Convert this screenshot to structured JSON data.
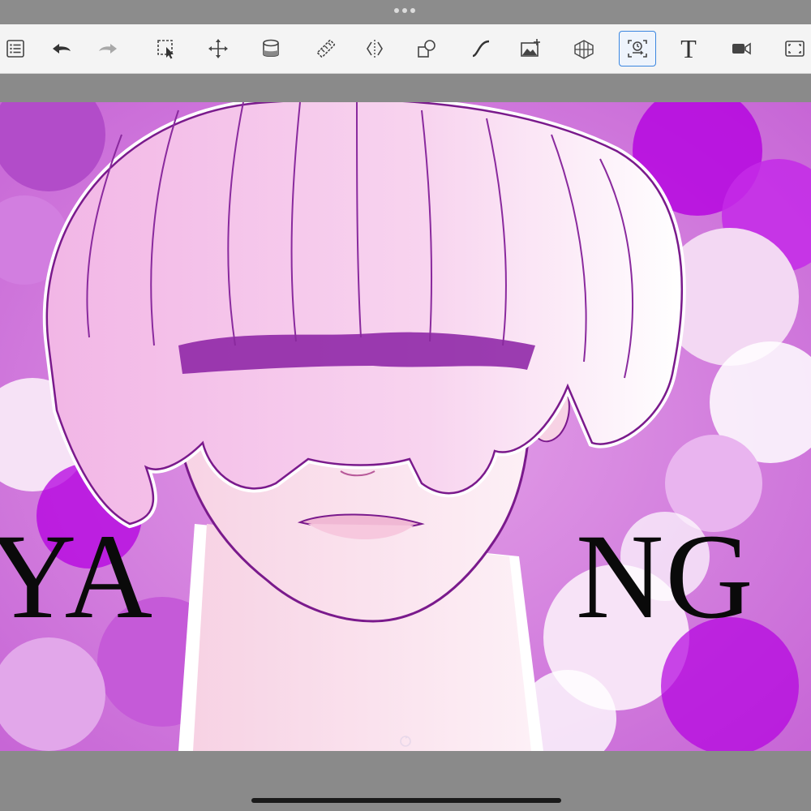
{
  "toolbar": {
    "tools": [
      {
        "name": "layers-list-icon",
        "active": false
      },
      {
        "name": "undo-icon",
        "active": false
      },
      {
        "name": "redo-icon",
        "active": false
      },
      {
        "name": "selection-icon",
        "active": false
      },
      {
        "name": "transform-move-icon",
        "active": false
      },
      {
        "name": "fill-bucket-icon",
        "active": false
      },
      {
        "name": "ruler-icon",
        "active": false
      },
      {
        "name": "symmetry-icon",
        "active": false
      },
      {
        "name": "shape-icon",
        "active": false
      },
      {
        "name": "curve-icon",
        "active": false
      },
      {
        "name": "add-image-icon",
        "active": false
      },
      {
        "name": "perspective-guide-icon",
        "active": false
      },
      {
        "name": "time-lapse-icon",
        "active": true
      },
      {
        "name": "text-tool-icon",
        "active": false
      },
      {
        "name": "video-record-icon",
        "active": false
      },
      {
        "name": "fullscreen-icon",
        "active": false
      }
    ],
    "text_tool_label": "T"
  },
  "artwork": {
    "text_left": "YA",
    "text_right": "NG",
    "colors": {
      "background": "#c766d6",
      "accent_purple": "#b400e0",
      "skin": "#f9dcea",
      "hair": "#f1b8e6",
      "line": "#7a1a8c"
    }
  }
}
